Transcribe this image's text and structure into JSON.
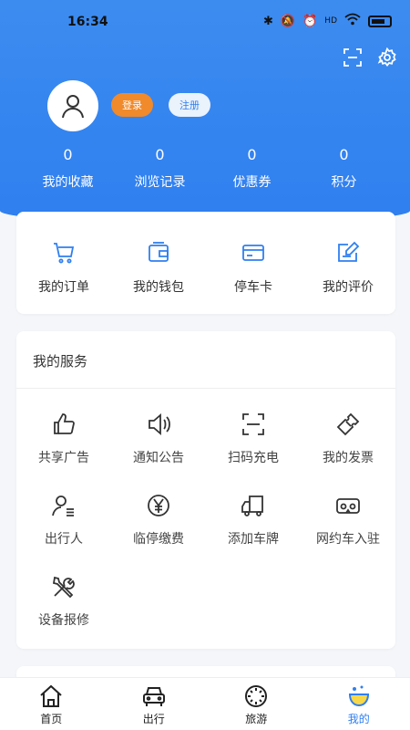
{
  "status_bar": {
    "time": "16:34",
    "network": "HD"
  },
  "header_actions": {
    "scan": "scan-icon",
    "settings": "gear-icon"
  },
  "profile": {
    "login_label": "登录",
    "register_label": "注册"
  },
  "stats": [
    {
      "value": "0",
      "label": "我的收藏"
    },
    {
      "value": "0",
      "label": "浏览记录"
    },
    {
      "value": "0",
      "label": "优惠券"
    },
    {
      "value": "0",
      "label": "积分"
    }
  ],
  "orders": [
    {
      "label": "我的订单",
      "icon": "cart-icon"
    },
    {
      "label": "我的钱包",
      "icon": "wallet-icon"
    },
    {
      "label": "停车卡",
      "icon": "card-icon"
    },
    {
      "label": "我的评价",
      "icon": "edit-icon"
    }
  ],
  "services": {
    "title": "我的服务",
    "items": [
      {
        "label": "共享广告",
        "icon": "thumb-up-icon"
      },
      {
        "label": "通知公告",
        "icon": "speaker-icon"
      },
      {
        "label": "扫码充电",
        "icon": "scan-icon"
      },
      {
        "label": "我的发票",
        "icon": "ticket-icon"
      },
      {
        "label": "出行人",
        "icon": "person-list-icon"
      },
      {
        "label": "临停缴费",
        "icon": "yen-icon"
      },
      {
        "label": "添加车牌",
        "icon": "truck-icon"
      },
      {
        "label": "网约车入驻",
        "icon": "vr-icon"
      },
      {
        "label": "设备报修",
        "icon": "tools-icon"
      }
    ]
  },
  "tabbar": [
    {
      "label": "首页",
      "icon": "home-icon"
    },
    {
      "label": "出行",
      "icon": "car-icon"
    },
    {
      "label": "旅游",
      "icon": "compass-icon"
    },
    {
      "label": "我的",
      "icon": "mine-icon",
      "active": true
    }
  ],
  "colors": {
    "primary": "#2f7ff0",
    "accent": "#f08a2a"
  }
}
